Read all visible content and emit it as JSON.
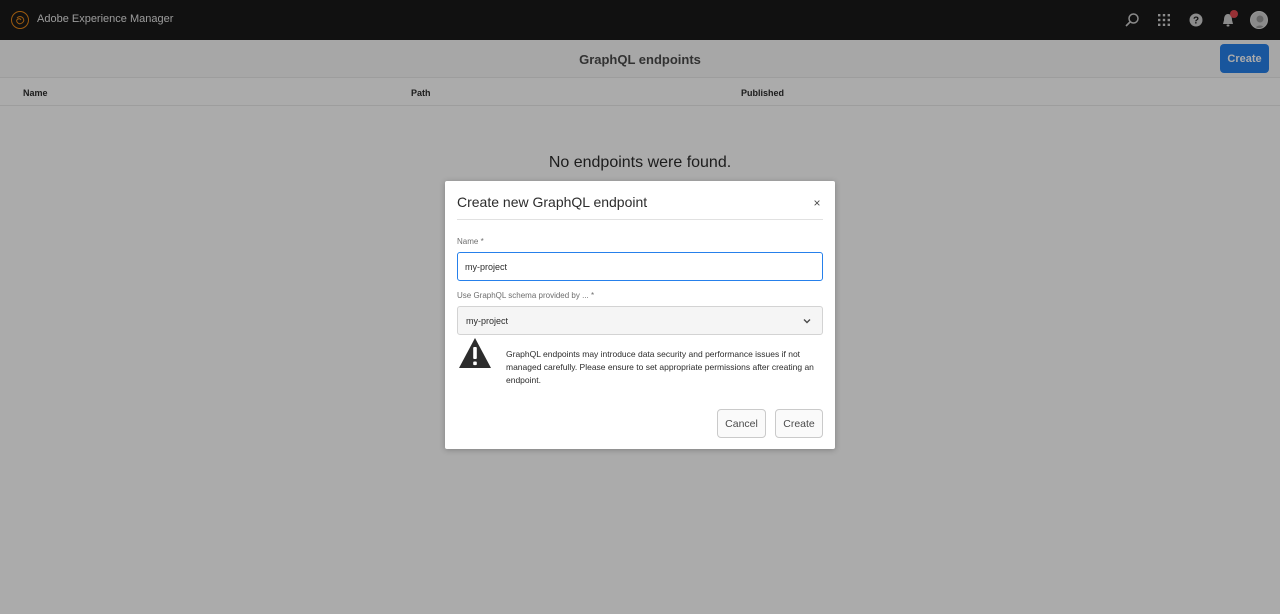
{
  "shell": {
    "brand": "Adobe Experience Manager",
    "icons": [
      "search-icon",
      "apps-icon",
      "help-icon",
      "bell-icon",
      "avatar"
    ],
    "accent": "#e68619"
  },
  "page": {
    "title": "GraphQL endpoints",
    "create_label": "Create",
    "accent": "#2680eb"
  },
  "table": {
    "columns": [
      "Name",
      "Path",
      "Published"
    ],
    "empty_message": "No endpoints were found."
  },
  "dialog": {
    "title": "Create new GraphQL endpoint",
    "close_glyph": "×",
    "name_label": "Name *",
    "name_value": "my-project",
    "schema_label": "Use GraphQL schema provided by ... *",
    "schema_value": "my-project",
    "warning": "GraphQL endpoints may introduce data security and performance issues if not managed carefully. Please ensure to set appropriate permissions after creating an endpoint.",
    "cancel_label": "Cancel",
    "create_label": "Create"
  }
}
